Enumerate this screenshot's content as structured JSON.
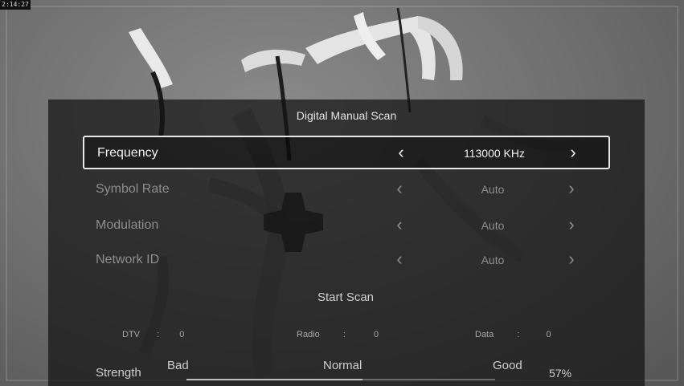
{
  "clock": "2:14:27",
  "dialog": {
    "title": "Digital Manual Scan",
    "rows": [
      {
        "label": "Frequency",
        "value": "113000 KHz"
      },
      {
        "label": "Symbol Rate",
        "value": "Auto"
      },
      {
        "label": "Modulation",
        "value": "Auto"
      },
      {
        "label": "Network ID",
        "value": "Auto"
      }
    ],
    "arrows": {
      "left": "‹",
      "right": "›"
    },
    "start_scan": "Start Scan",
    "counts": [
      {
        "label": "DTV",
        "sep": ":",
        "value": "0"
      },
      {
        "label": "Radio",
        "sep": ":",
        "value": "0"
      },
      {
        "label": "Data",
        "sep": ":",
        "value": "0"
      }
    ],
    "strength": {
      "label": "Strength",
      "levels": [
        "Bad",
        "Normal",
        "Good"
      ],
      "percent_text": "57%",
      "fraction": 0.57
    }
  }
}
